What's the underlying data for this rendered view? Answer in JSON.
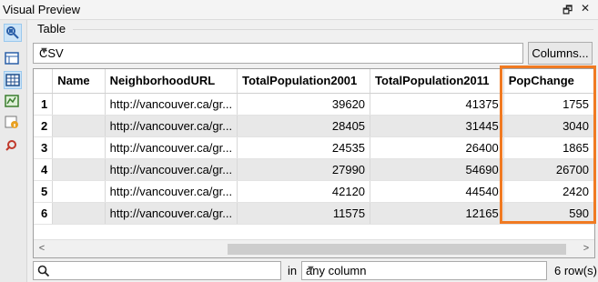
{
  "window": {
    "title": "Visual Preview",
    "restore_icon": "restore-icon",
    "close_icon": "close-icon",
    "restore_glyph": "🗗",
    "close_glyph": "✕"
  },
  "toolbar": {
    "icons": [
      "inspect-icon",
      "panel-icon",
      "table-icon",
      "map-icon",
      "info-icon",
      "settings-icon"
    ]
  },
  "section": {
    "label": "Table"
  },
  "format_select": {
    "value": "CSV"
  },
  "columns_button": {
    "label": "Columns..."
  },
  "table": {
    "columns": [
      "Name",
      "NeighborhoodURL",
      "TotalPopulation2001",
      "TotalPopulation2011",
      "PopChange"
    ],
    "rows": [
      {
        "index": "1",
        "name": "",
        "url": "http://vancouver.ca/gr...",
        "pop2001": "39620",
        "pop2011": "41375",
        "change": "1755"
      },
      {
        "index": "2",
        "name": "",
        "url": "http://vancouver.ca/gr...",
        "pop2001": "28405",
        "pop2011": "31445",
        "change": "3040"
      },
      {
        "index": "3",
        "name": "",
        "url": "http://vancouver.ca/gr...",
        "pop2001": "24535",
        "pop2011": "26400",
        "change": "1865"
      },
      {
        "index": "4",
        "name": "",
        "url": "http://vancouver.ca/gr...",
        "pop2001": "27990",
        "pop2011": "54690",
        "change": "26700"
      },
      {
        "index": "5",
        "name": "",
        "url": "http://vancouver.ca/gr...",
        "pop2001": "42120",
        "pop2011": "44540",
        "change": "2420"
      },
      {
        "index": "6",
        "name": "",
        "url": "http://vancouver.ca/gr...",
        "pop2001": "11575",
        "pop2011": "12165",
        "change": "590"
      }
    ],
    "highlight_color": "#f07a22"
  },
  "scroll": {
    "left_glyph": "<",
    "right_glyph": ">"
  },
  "search": {
    "placeholder": "",
    "value": "",
    "in_label": "in",
    "column_value": "any column",
    "row_count": "6 row(s)"
  }
}
